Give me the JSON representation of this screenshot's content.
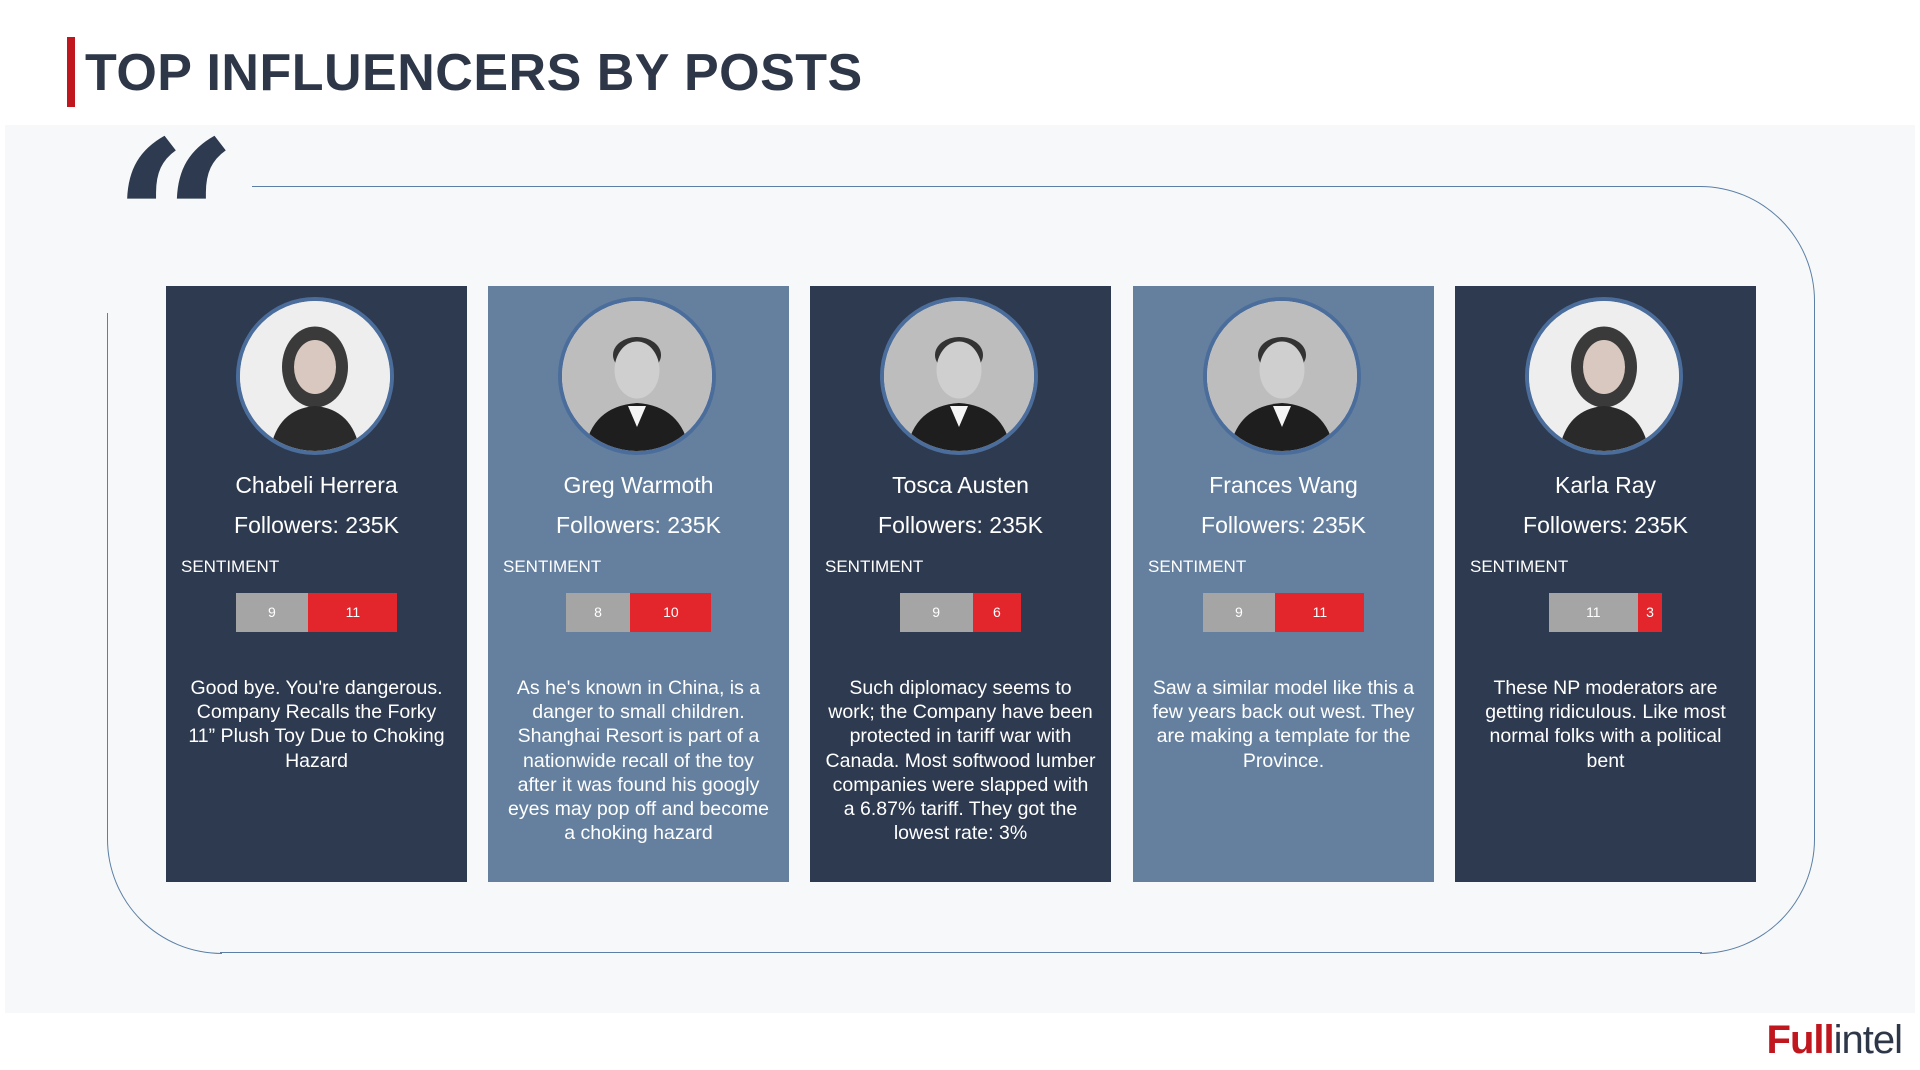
{
  "page": {
    "title": "TOP INFLUENCERS BY POSTS",
    "logo_part1": "Full",
    "logo_part2": "intel"
  },
  "colors": {
    "accent_red": "#c0161e",
    "card_dark": "#2d3a4f",
    "card_light": "#65809f",
    "sentiment_negative": "#a5a5a5",
    "sentiment_positive": "#e2262b"
  },
  "sentiment_label": "SENTIMENT",
  "influencers": [
    {
      "name": "Chabeli Herrera",
      "followers": "Followers: 235K",
      "sentiment_a": 9,
      "sentiment_b": 11,
      "quote": "Good bye. You're dangerous. Company Recalls the Forky 11” Plush Toy Due to Choking Hazard",
      "avatar_icon": "woman-portrait-icon"
    },
    {
      "name": "Greg Warmoth",
      "followers": "Followers: 235K",
      "sentiment_a": 8,
      "sentiment_b": 10,
      "quote": "As he's known in China, is a danger to small children. Shanghai Resort is part of a nationwide recall of the toy after it was found his googly eyes may pop off and become a choking hazard",
      "avatar_icon": "man-portrait-icon"
    },
    {
      "name": "Tosca Austen",
      "followers": "Followers: 235K",
      "sentiment_a": 9,
      "sentiment_b": 6,
      "quote": "Such diplomacy seems to work; the Company have been protected in tariff war with Canada. Most softwood lumber companies were slapped with a 6.87% tariff. They got the lowest rate: 3%",
      "avatar_icon": "man-portrait-icon"
    },
    {
      "name": "Frances Wang",
      "followers": "Followers: 235K",
      "sentiment_a": 9,
      "sentiment_b": 11,
      "quote": "Saw a similar model like this a few years back out west. They are making a template for the Province.",
      "avatar_icon": "man-portrait-icon"
    },
    {
      "name": "Karla Ray",
      "followers": "Followers: 235K",
      "sentiment_a": 11,
      "sentiment_b": 3,
      "quote": "These NP moderators are getting ridiculous. Like most normal folks with a political bent",
      "avatar_icon": "woman-portrait-icon"
    }
  ]
}
